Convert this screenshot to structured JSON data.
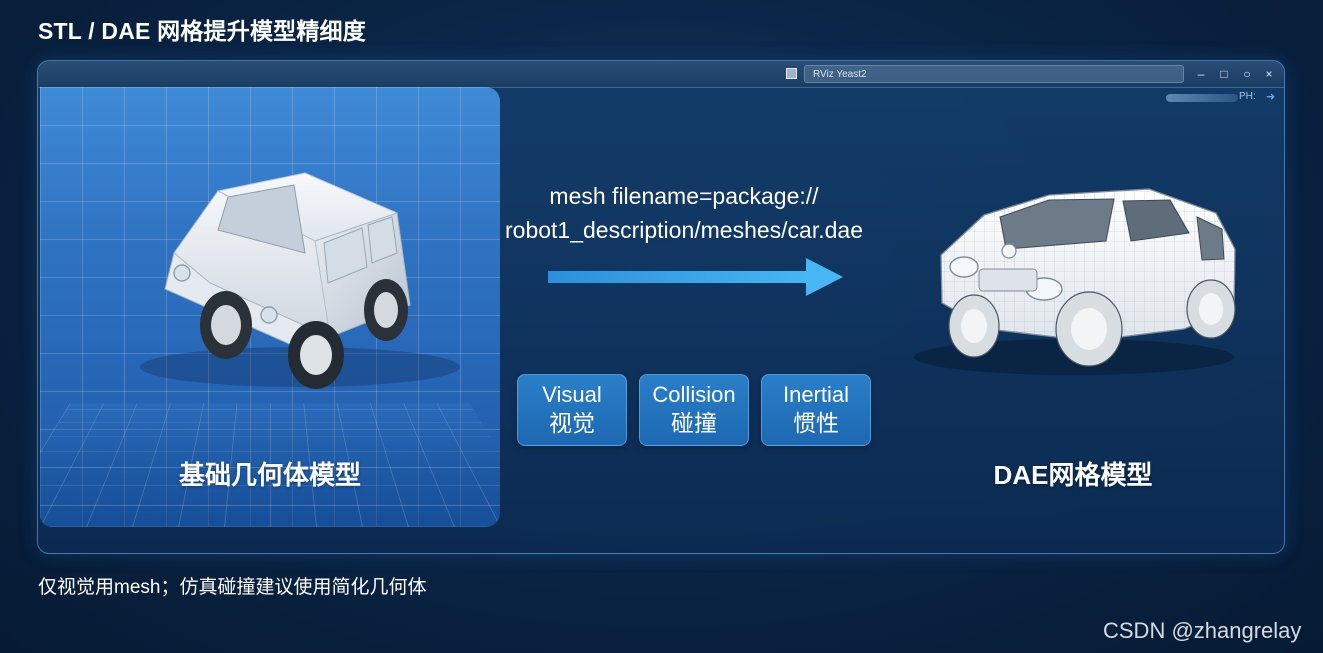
{
  "page": {
    "title": "STL / DAE 网格提升模型精细度",
    "footnote": "仅视觉用mesh；仿真碰撞建议使用简化几何体",
    "watermark": "CSDN @zhangrelay"
  },
  "window": {
    "address_text": "RViz Yeast2",
    "status_text": "PH:",
    "controls": {
      "minimize": "–",
      "maximize": "□",
      "restore": "○",
      "close": "×"
    }
  },
  "left_panel": {
    "caption": "基础几何体模型"
  },
  "middle": {
    "mesh_lines": [
      "mesh filename=package://",
      "robot1_description/meshes/car.dae"
    ],
    "tags": [
      {
        "en": "Visual",
        "cn": "视觉"
      },
      {
        "en": "Collision",
        "cn": "碰撞"
      },
      {
        "en": "Inertial",
        "cn": "惯性"
      }
    ]
  },
  "right_panel": {
    "caption": "DAE网格模型"
  },
  "colors": {
    "background": "#0b2648",
    "accent": "#2f9ae0",
    "panel_blue": "#2f73c3"
  }
}
